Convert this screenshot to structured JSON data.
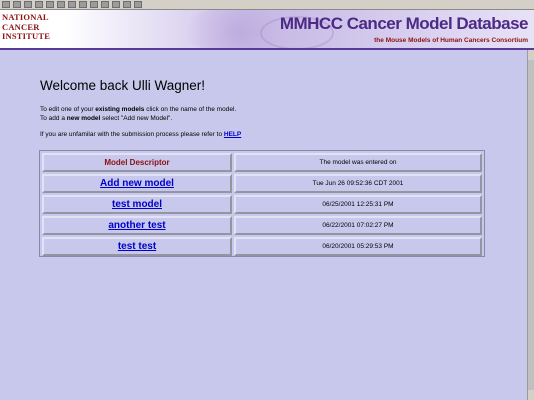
{
  "browser": {
    "toolbar_icons": [
      "back-icon",
      "forward-icon",
      "stop-icon",
      "refresh-icon",
      "home-icon",
      "search-icon",
      "favorites-icon",
      "history-icon",
      "mail-icon",
      "print-icon",
      "edit-icon",
      "discuss-icon",
      "messenger-icon"
    ]
  },
  "header": {
    "logo_lines": [
      "NATIONAL",
      "CANCER",
      "INSTITUTE"
    ],
    "site_title": "MMHCC Cancer Model Database",
    "site_subtitle": "the Mouse Models of Human Cancers Consortium"
  },
  "content": {
    "welcome": "Welcome back Ulli Wagner!",
    "edit_prefix": "To edit one of your ",
    "edit_bold": "existing models",
    "edit_suffix": " click on the name of the model.",
    "add_prefix": "To add a ",
    "add_bold": "new model",
    "add_suffix": " select \"Add new Model\".",
    "help_prefix": "If you are unfamilar with the submission process please refer to ",
    "help_link": "HELP"
  },
  "table": {
    "header_descriptor": "Model Descriptor",
    "header_date": "The model was entered on",
    "rows": [
      {
        "name": "Add new model",
        "date": "Tue Jun 26 09:52:36 CDT 2001"
      },
      {
        "name": "test model",
        "date": "06/25/2001 12:25:31 PM"
      },
      {
        "name": "another test",
        "date": "06/22/2001 07:02:27 PM"
      },
      {
        "name": "test test",
        "date": "06/20/2001 05:29:53 PM"
      }
    ]
  },
  "colors": {
    "page_background": "#c8c8ec",
    "link": "#0000cc",
    "header_text": "#8b1010",
    "banner_title": "#4d2a86"
  }
}
